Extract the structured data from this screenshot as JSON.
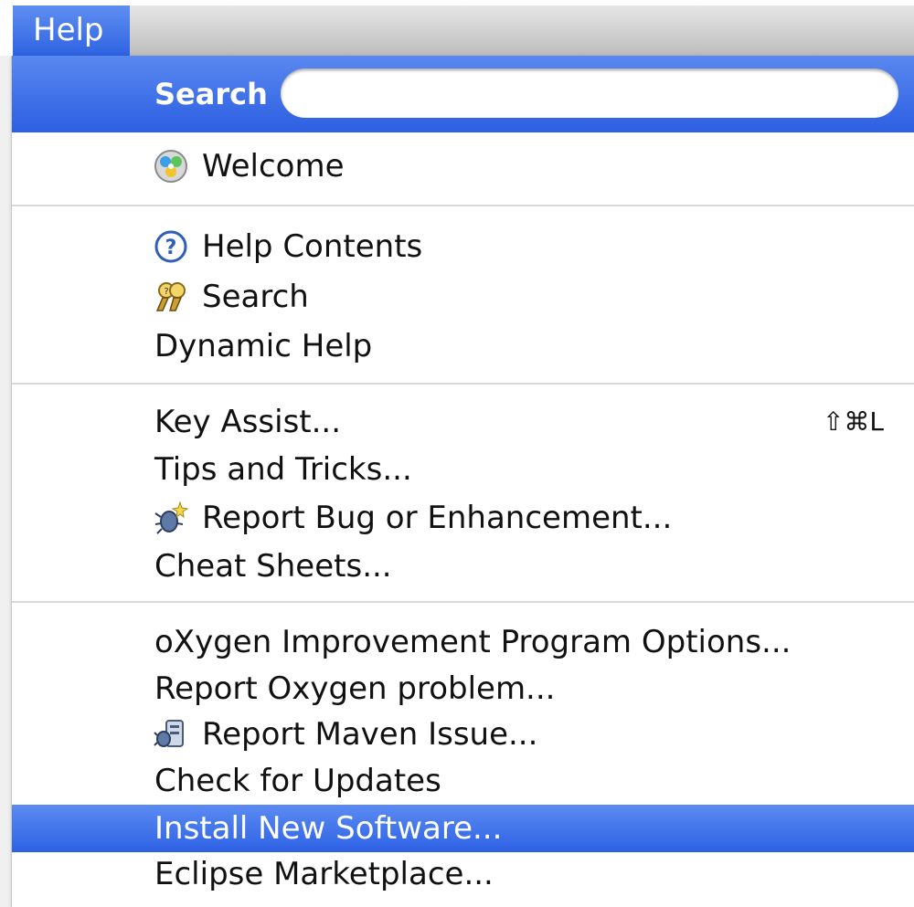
{
  "menubar": {
    "help_label": "Help"
  },
  "menu": {
    "search": {
      "label": "Search",
      "value": "",
      "placeholder": ""
    },
    "items": [
      {
        "label": "Welcome",
        "icon": "welcome-icon"
      },
      {
        "label": "Help Contents",
        "icon": "help-question-icon"
      },
      {
        "label": "Search",
        "icon": "search-binoculars-icon"
      },
      {
        "label": "Dynamic Help"
      },
      {
        "label": "Key Assist...",
        "shortcut": "⇧⌘L"
      },
      {
        "label": "Tips and Tricks..."
      },
      {
        "label": "Report Bug or Enhancement...",
        "icon": "bug-report-icon"
      },
      {
        "label": "Cheat Sheets..."
      },
      {
        "label": "oXygen Improvement Program Options..."
      },
      {
        "label": "Report Oxygen problem..."
      },
      {
        "label": "Report Maven Issue...",
        "icon": "maven-icon"
      },
      {
        "label": "Check for Updates"
      },
      {
        "label": "Install New Software...",
        "highlighted": true
      },
      {
        "label": "Eclipse Marketplace..."
      }
    ]
  },
  "colors": {
    "highlight": "#3b6fe8",
    "separator": "#d8d8d8"
  }
}
